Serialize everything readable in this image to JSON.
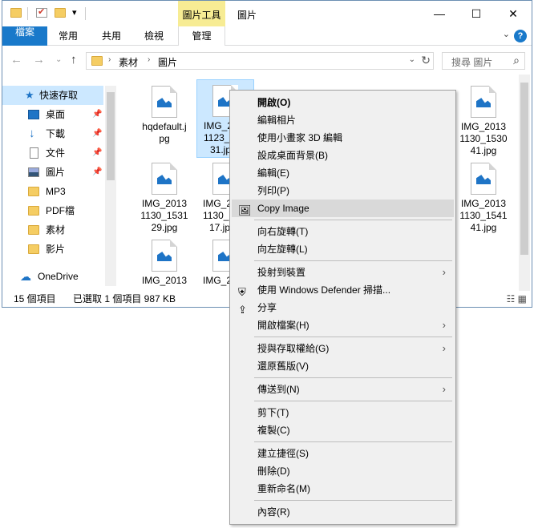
{
  "titlebar": {
    "title": "圖片",
    "context_tab": "圖片工具",
    "minimize_glyph": "—",
    "maximize_glyph": "☐",
    "close_glyph": "✕",
    "qa_dropdown_glyph": "▾",
    "qa_pipe_glyph": "|"
  },
  "ribbon": {
    "tabs": [
      "檔案",
      "常用",
      "共用",
      "檢視",
      "管理"
    ],
    "collapse_glyph": "⌄",
    "help_glyph": "?"
  },
  "address": {
    "back_glyph": "←",
    "forward_glyph": "→",
    "recent_glyph": "⌄",
    "up_glyph": "↑",
    "crumbs": [
      "素材",
      "圖片"
    ],
    "crumb_sep": "›",
    "dropdown_glyph": "⌄",
    "refresh_glyph": "↻",
    "search_placeholder": "搜尋 圖片",
    "search_glyph": "⌕"
  },
  "navpane": {
    "pin_glyph": "📌",
    "items": [
      {
        "label": "快速存取",
        "icon": "star-icon",
        "pinned": false
      },
      {
        "label": "桌面",
        "icon": "desktop-icon",
        "pinned": true
      },
      {
        "label": "下載",
        "icon": "download-icon",
        "pinned": true
      },
      {
        "label": "文件",
        "icon": "document-icon",
        "pinned": true
      },
      {
        "label": "圖片",
        "icon": "pictures-icon",
        "pinned": true
      },
      {
        "label": "MP3",
        "icon": "folder-icon",
        "pinned": false
      },
      {
        "label": "PDF檔",
        "icon": "folder-icon",
        "pinned": false
      },
      {
        "label": "素材",
        "icon": "folder-icon",
        "pinned": false
      },
      {
        "label": "影片",
        "icon": "folder-icon",
        "pinned": false
      },
      {
        "label": "OneDrive",
        "icon": "cloud-icon",
        "pinned": false
      }
    ]
  },
  "files": [
    {
      "name": "hqdefault.jpg",
      "lines": [
        "hqdefault.j",
        "pg"
      ]
    },
    {
      "name": "IMG_20131123_...31.jpg",
      "lines": [
        "IMG_2",
        "1123_",
        "31.jp"
      ],
      "selected": true
    },
    {
      "name": "IMG_20131130_153041.jpg",
      "lines": [
        "IMG_2013",
        "1130_1530",
        "41.jpg"
      ]
    },
    {
      "name": "IMG_20131130_153129.jpg",
      "lines": [
        "IMG_2013",
        "1130_1531",
        "29.jpg"
      ]
    },
    {
      "name": "IMG_2013..._17.jpg",
      "lines": [
        "IMG_2",
        "1130_",
        "17.jp"
      ]
    },
    {
      "name": "IMG_20131130_154141.jpg",
      "lines": [
        "IMG_2013",
        "1130_1541",
        "41.jpg"
      ]
    },
    {
      "name": "IMG_2013",
      "lines": [
        "IMG_2013"
      ]
    },
    {
      "name": "IMG_2",
      "lines": [
        "IMG_2"
      ]
    }
  ],
  "status": {
    "count": "15 個項目",
    "selection": "已選取 1 個項目 987 KB",
    "view_icons_glyph": "☷ ▦"
  },
  "context_menu": {
    "submenu_arrow": "›",
    "items": [
      {
        "label": "開啟(O)",
        "bold": true
      },
      {
        "label": "編輯相片"
      },
      {
        "label": "使用小畫家 3D 編輯"
      },
      {
        "label": "設成桌面背景(B)"
      },
      {
        "label": "編輯(E)"
      },
      {
        "label": "列印(P)"
      },
      {
        "label": "Copy Image",
        "icon": "image-icon",
        "glyph": "🖼",
        "hover": true
      },
      {
        "sep": true
      },
      {
        "label": "向右旋轉(T)"
      },
      {
        "label": "向左旋轉(L)"
      },
      {
        "sep": true
      },
      {
        "label": "投射到裝置",
        "submenu": true
      },
      {
        "label": "使用 Windows Defender 掃描...",
        "icon": "defender-shield-icon",
        "glyph": "⛨"
      },
      {
        "label": "分享",
        "icon": "share-icon",
        "glyph": "⇪"
      },
      {
        "label": "開啟檔案(H)",
        "submenu": true
      },
      {
        "sep": true
      },
      {
        "label": "授與存取權給(G)",
        "submenu": true
      },
      {
        "label": "還原舊版(V)"
      },
      {
        "sep": true
      },
      {
        "label": "傳送到(N)",
        "submenu": true
      },
      {
        "sep": true
      },
      {
        "label": "剪下(T)"
      },
      {
        "label": "複製(C)"
      },
      {
        "sep": true
      },
      {
        "label": "建立捷徑(S)"
      },
      {
        "label": "刪除(D)"
      },
      {
        "label": "重新命名(M)"
      },
      {
        "sep": true
      },
      {
        "label": "內容(R)"
      }
    ]
  },
  "colors": {
    "accent": "#1979ca",
    "context_tab": "#f7ec94",
    "selection": "#cce8ff",
    "menu_bg": "#f0f0f0"
  }
}
